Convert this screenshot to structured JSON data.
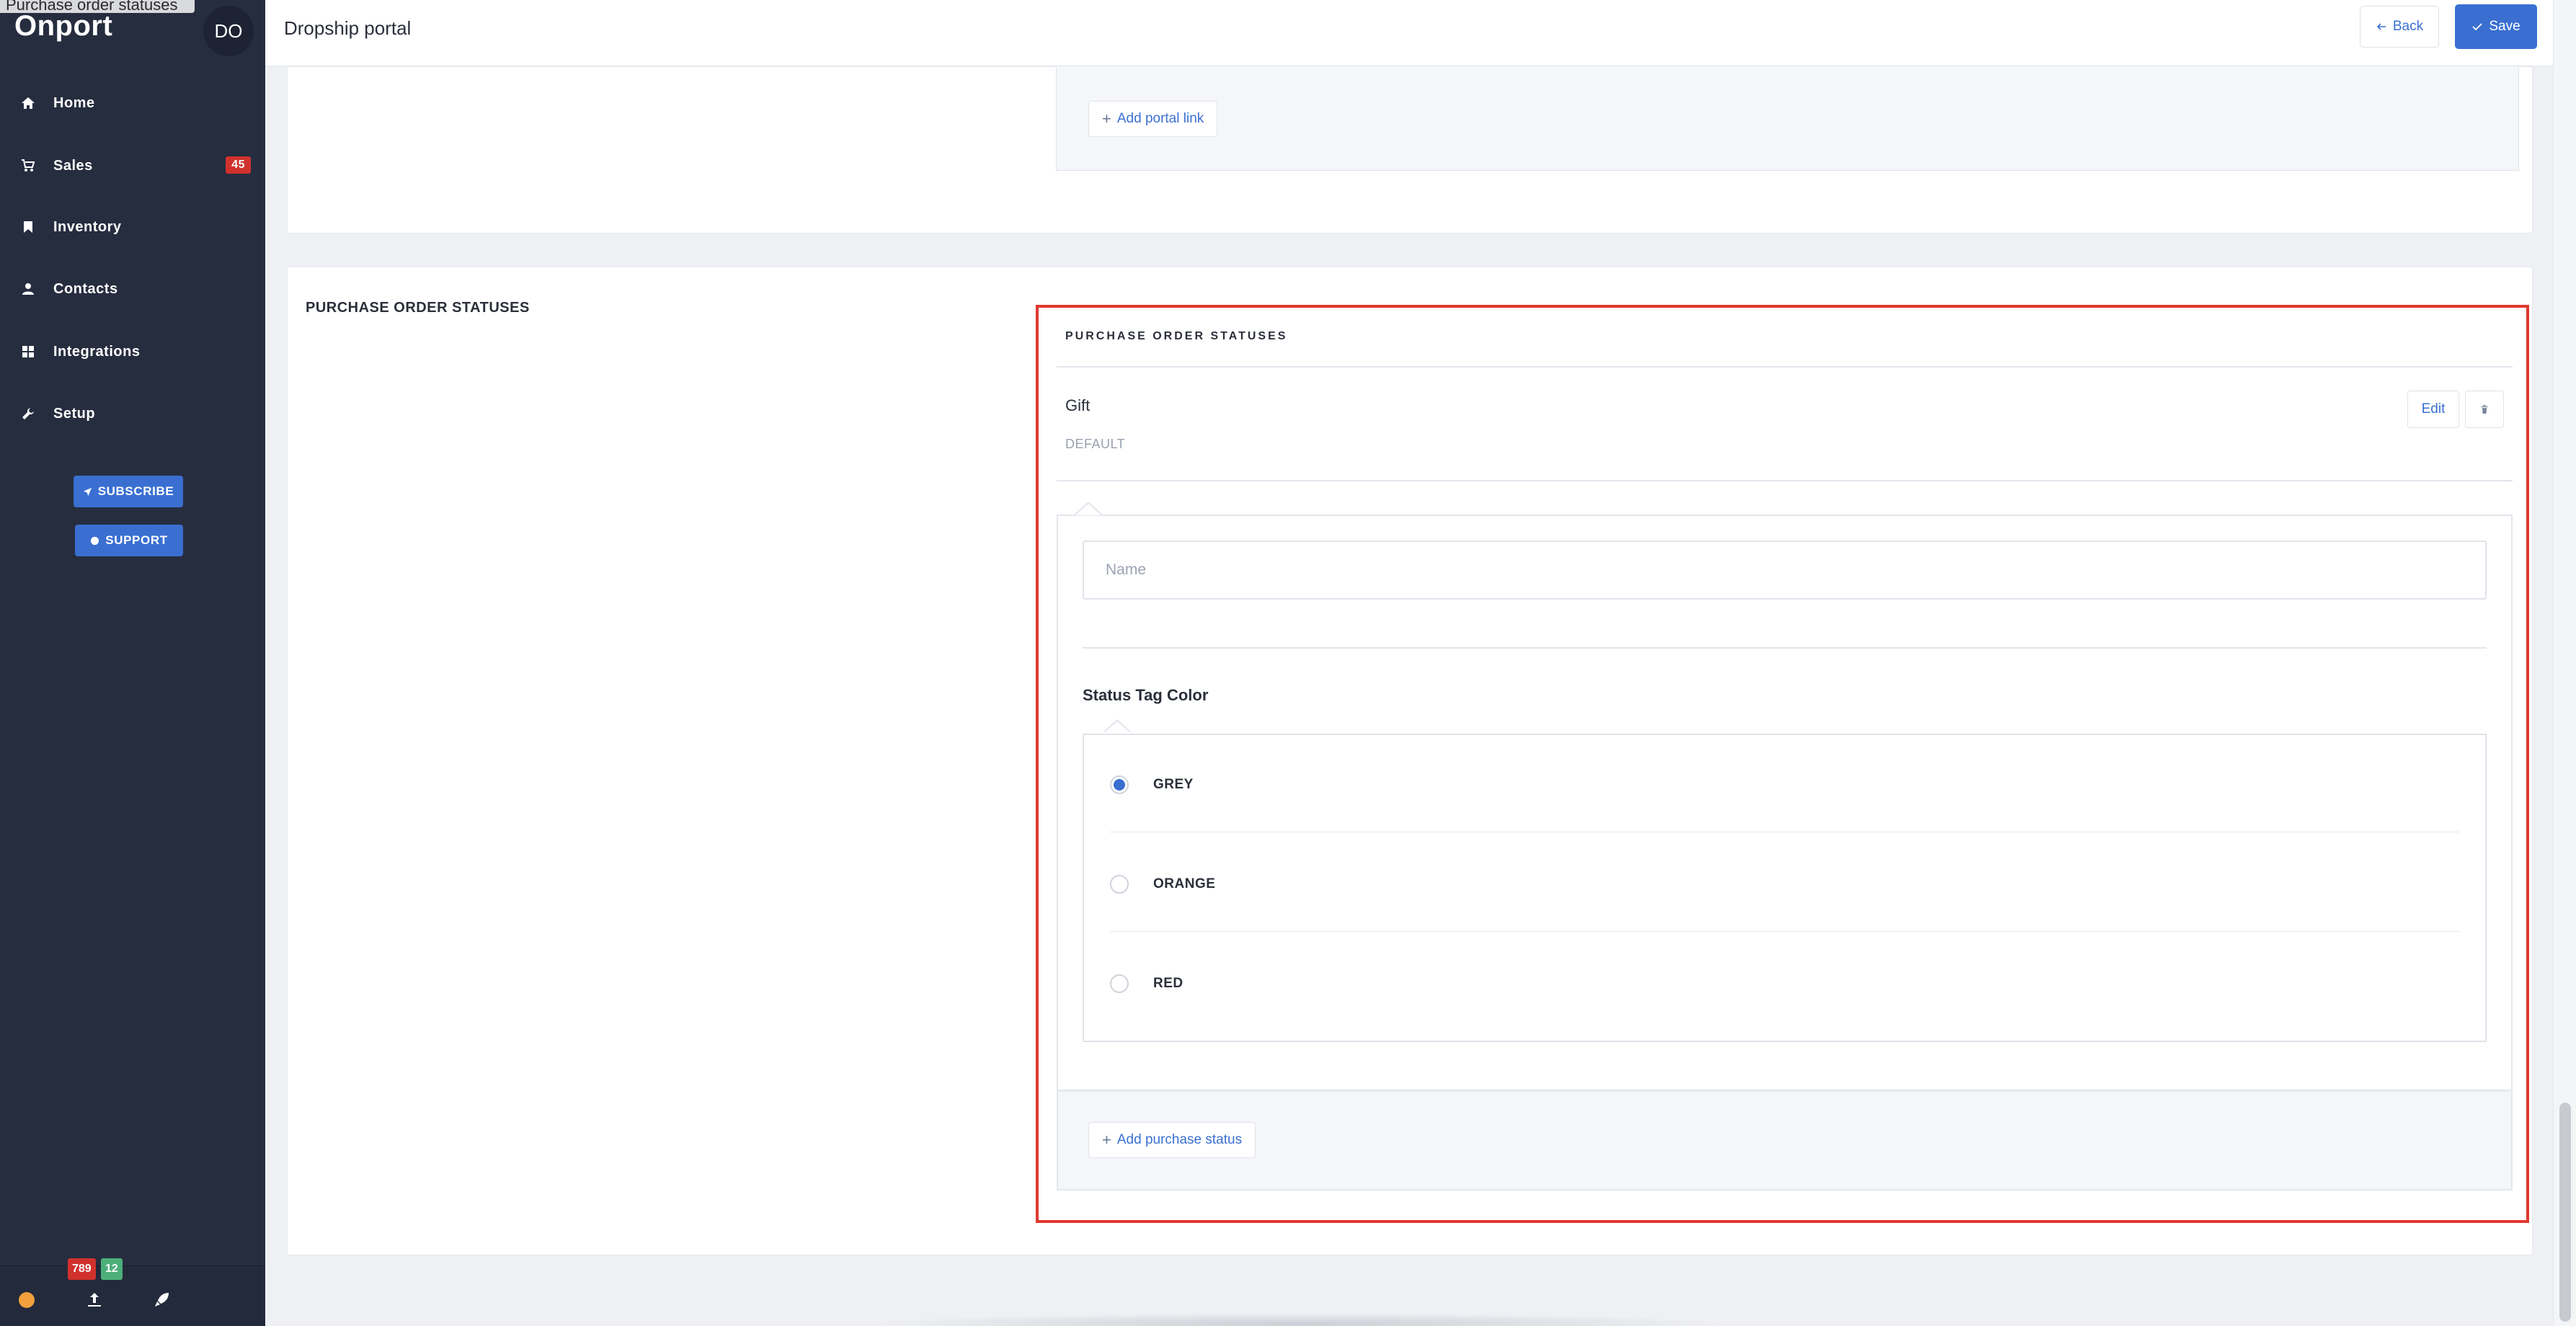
{
  "tooltip": "Purchase order statuses",
  "app": {
    "logo": "Onport",
    "avatar": "DO"
  },
  "nav": {
    "items": [
      {
        "label": "Home",
        "icon": "home-icon"
      },
      {
        "label": "Sales",
        "icon": "cart-icon",
        "badge": "45"
      },
      {
        "label": "Inventory",
        "icon": "bookmark-icon"
      },
      {
        "label": "Contacts",
        "icon": "user-icon"
      },
      {
        "label": "Integrations",
        "icon": "grid-icon"
      },
      {
        "label": "Setup",
        "icon": "wrench-icon"
      }
    ],
    "subscribe": "SUBSCRIBE",
    "support": "SUPPORT"
  },
  "footer": {
    "badge_red": "789",
    "badge_green": "12"
  },
  "topbar": {
    "title": "Dropship portal",
    "back": "Back",
    "save": "Save"
  },
  "portal_links": {
    "add_label": "Add portal link"
  },
  "purchase_statuses": {
    "section_title": "PURCHASE ORDER STATUSES",
    "header": "PURCHASE ORDER STATUSES",
    "status": {
      "name": "Gift",
      "tag": "DEFAULT",
      "edit": "Edit"
    },
    "form": {
      "name_value": "",
      "name_placeholder": "Name",
      "color_label": "Status Tag Color",
      "colors": [
        {
          "label": "GREY",
          "selected": true
        },
        {
          "label": "ORANGE",
          "selected": false
        },
        {
          "label": "RED",
          "selected": false
        }
      ]
    },
    "add_label": "Add purchase status"
  },
  "colors": {
    "accent": "#3a6fd1",
    "sidebar": "#262d3f",
    "highlight": "#e0382e",
    "badge_red": "#d0312d",
    "badge_green": "#4caf7a"
  }
}
